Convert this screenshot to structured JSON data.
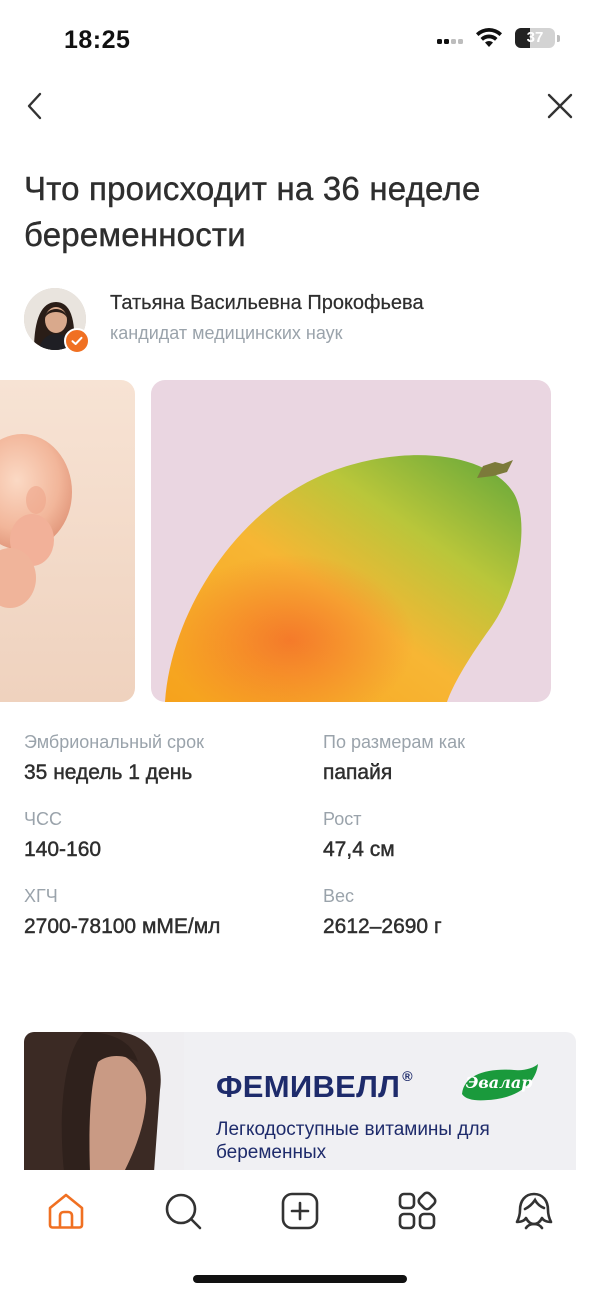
{
  "status_bar": {
    "time": "18:25",
    "battery": "37",
    "battery_level": 0.37
  },
  "nav": {
    "back_icon": "chevron-left-icon",
    "close_icon": "close-icon"
  },
  "article": {
    "title": "Что происходит на 36 неделе беременности"
  },
  "author": {
    "name": "Татьяна Васильевна Прокофьева",
    "role": "кандидат медицинских наук",
    "verified": true
  },
  "stats": [
    {
      "label": "Эмбриональный срок",
      "value": "35 недель 1 день"
    },
    {
      "label": "По размерам как",
      "value": "папайя"
    },
    {
      "label": "ЧСС",
      "value": "140-160"
    },
    {
      "label": "Рост",
      "value": "47,4 см"
    },
    {
      "label": "ХГЧ",
      "value": "2700-78100 мМЕ/мл"
    },
    {
      "label": "Вес",
      "value": "2612–2690 г"
    }
  ],
  "ad": {
    "brand": "ФЕМИВЕЛЛ",
    "registered": "®",
    "logo_text": "Эвалар",
    "text": "Легкодоступные витамины для беременных",
    "brand_color": "#1e2b6b",
    "logo_color": "#1a9a3c"
  },
  "tab_bar": {
    "active": "home",
    "accent_color": "#f07022",
    "tabs": [
      "home",
      "search",
      "create",
      "services",
      "profile"
    ]
  }
}
